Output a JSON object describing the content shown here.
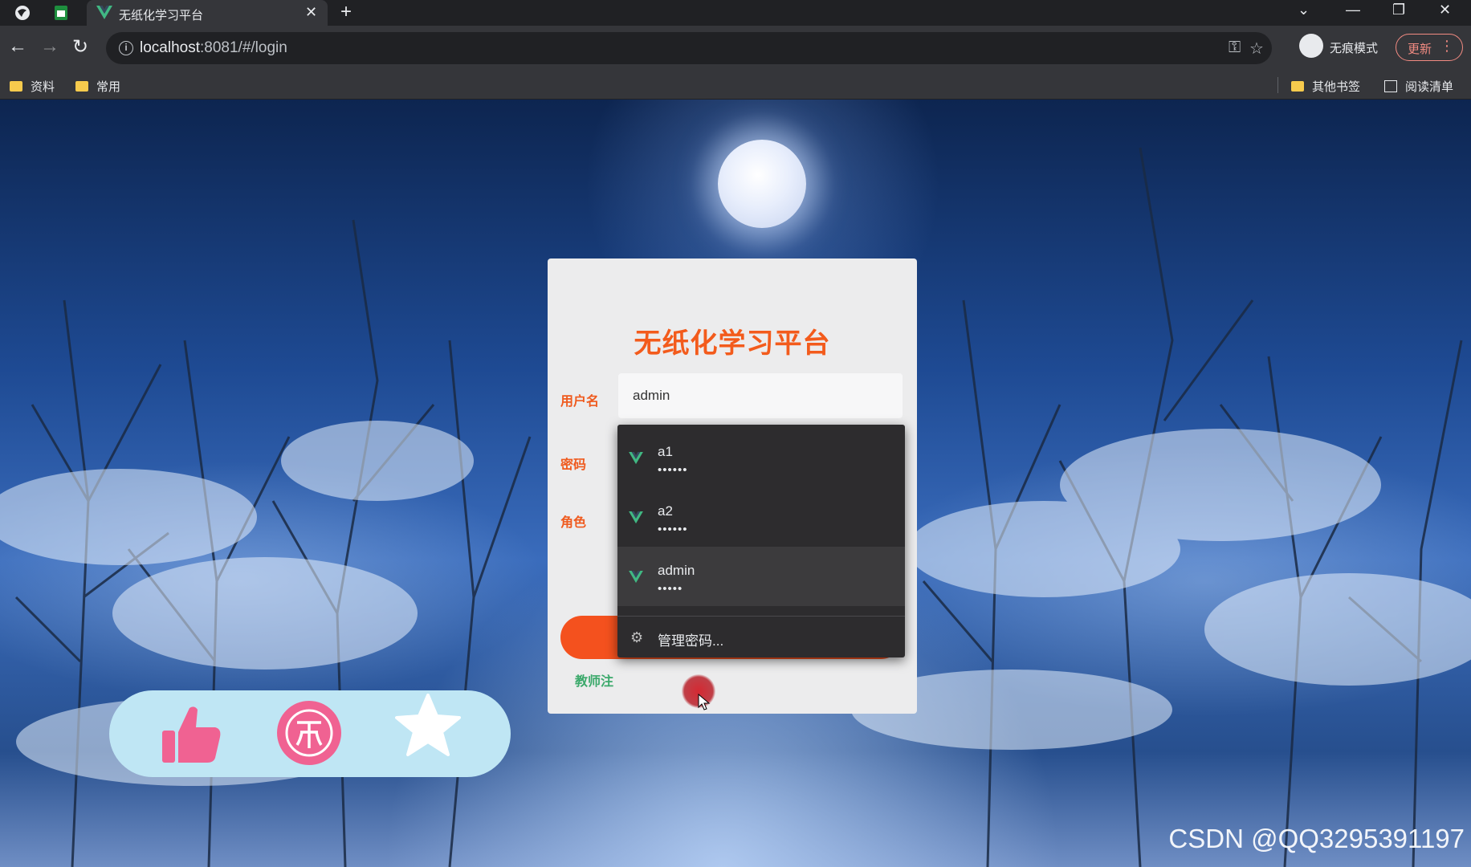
{
  "browser": {
    "tab_title": "无纸化学习平台",
    "url_host": "localhost",
    "url_rest": ":8081/#/login",
    "incognito_label": "无痕模式",
    "update_label": "更新",
    "bookmarks": {
      "left": [
        "资料",
        "常用"
      ],
      "other": "其他书签",
      "reading_list": "阅读清单"
    }
  },
  "login": {
    "title": "无纸化学习平台",
    "username_label": "用户名",
    "username_value": "admin",
    "password_label": "密码",
    "role_label": "角色",
    "register_link": "教师注"
  },
  "autofill": {
    "items": [
      {
        "user": "a1",
        "password": "••••••"
      },
      {
        "user": "a2",
        "password": "••••••"
      },
      {
        "user": "admin",
        "password": "•••••"
      }
    ],
    "manage": "管理密码..."
  },
  "watermark": "CSDN @QQ3295391197",
  "colors": {
    "accent": "#f4511e",
    "title": "#f35b1c",
    "link": "#3ba96b",
    "pill": "#bfe6f4",
    "pill_icon": "#f06292",
    "vue_green": "#41b883"
  },
  "icons": [
    "thumbs-up-icon",
    "coin-icon",
    "star-icon",
    "key-icon",
    "bookmark-star-icon",
    "gear-icon",
    "vue-logo-icon"
  ]
}
